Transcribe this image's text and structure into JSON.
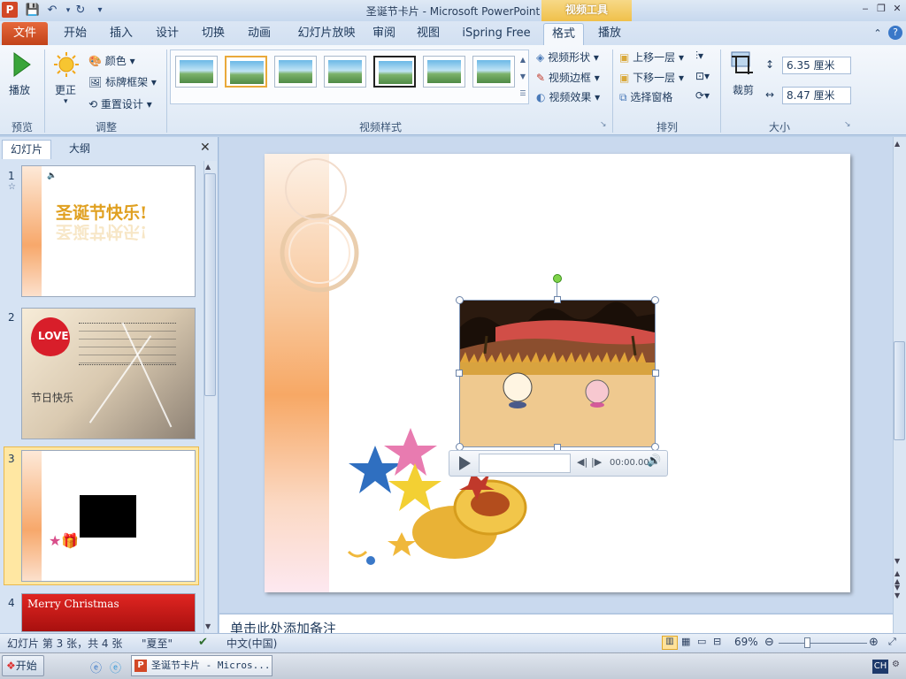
{
  "window": {
    "title": "圣诞节卡片 - Microsoft PowerPoint",
    "context_tab": "视频工具"
  },
  "tabs": {
    "file": "文件",
    "home": "开始",
    "insert": "插入",
    "design": "设计",
    "transitions": "切换",
    "animations": "动画",
    "slideshow": "幻灯片放映",
    "review": "审阅",
    "view": "视图",
    "ispring": "iSpring Free",
    "format": "格式",
    "playback": "播放"
  },
  "ribbon": {
    "preview": {
      "play": "播放",
      "group": "预览"
    },
    "adjust": {
      "correct": "更正",
      "color": "颜色",
      "poster": "标牌框架",
      "reset": "重置设计",
      "group": "调整"
    },
    "video_styles": {
      "group": "视频样式",
      "shape": "视频形状",
      "border": "视频边框",
      "effects": "视频效果"
    },
    "arrange": {
      "bring_forward": "上移一层",
      "send_backward": "下移一层",
      "selection_pane": "选择窗格",
      "group": "排列"
    },
    "size": {
      "crop": "裁剪",
      "height": "6.35 厘米",
      "width": "8.47 厘米",
      "group": "大小"
    }
  },
  "panel": {
    "tab_slides": "幻灯片",
    "tab_outline": "大纲",
    "slides": [
      {
        "num": "1",
        "title": "圣诞节快乐!"
      },
      {
        "num": "2",
        "title": "LOVE",
        "text": "节日快乐"
      },
      {
        "num": "3"
      },
      {
        "num": "4",
        "title": "Merry Christmas"
      }
    ]
  },
  "video": {
    "time": "00:00.00"
  },
  "notes": {
    "placeholder": "单击此处添加备注"
  },
  "status": {
    "slide_info": "幻灯片 第 3 张，共 4 张",
    "theme": "\"夏至\"",
    "language": "中文(中国)",
    "zoom": "69%"
  },
  "taskbar": {
    "start": "开始",
    "app": "圣诞节卡片 - Micros...",
    "lang": "CH"
  },
  "colors": {
    "file_tab": "#d4532a",
    "context_tab": "#f0c04a",
    "ribbon_bg": "#dde8f5",
    "selection": "#ffe7a2"
  }
}
